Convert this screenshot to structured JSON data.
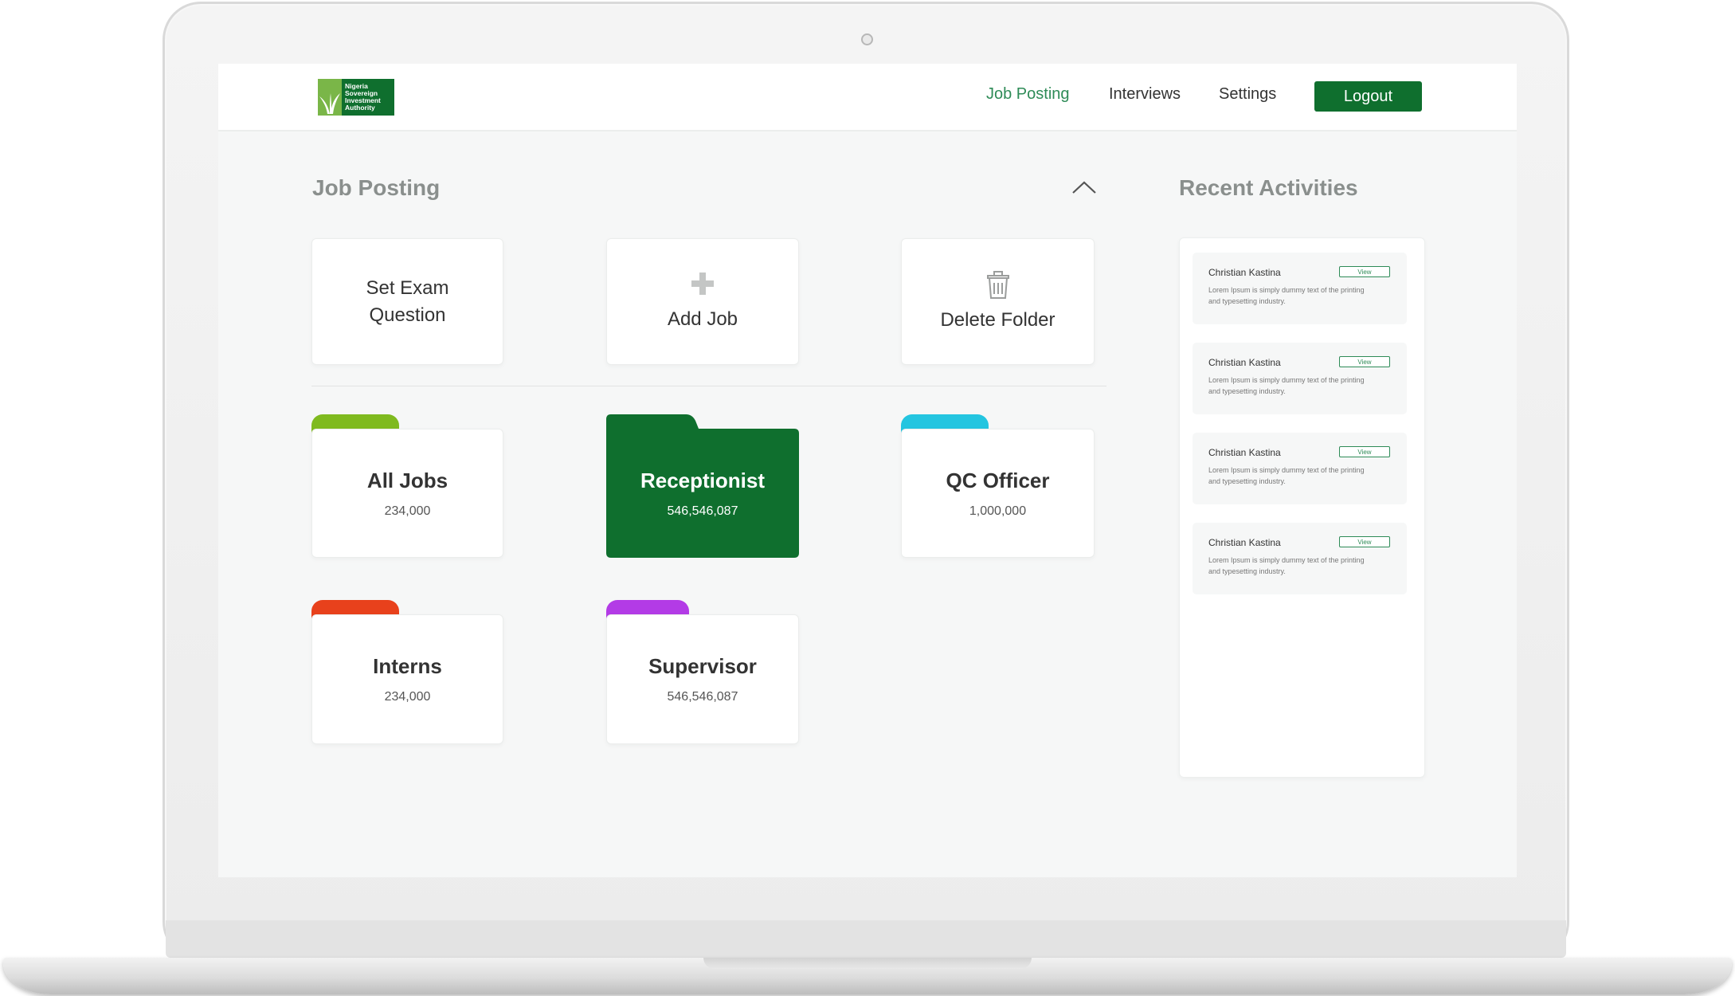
{
  "brand": {
    "logo_text": "Nigeria\nSovereign\nInvestment\nAuthority",
    "primary_color": "#0f6f2e",
    "accent_color": "#2e8b57"
  },
  "nav": {
    "items": [
      {
        "label": "Job Posting",
        "active": true
      },
      {
        "label": "Interviews",
        "active": false
      },
      {
        "label": "Settings",
        "active": false
      }
    ],
    "logout_label": "Logout"
  },
  "job_posting": {
    "title": "Job Posting",
    "collapse_icon": "chevron-up-icon",
    "actions": [
      {
        "label": "Set Exam\nQuestion",
        "icon": ""
      },
      {
        "label": "Add Job",
        "icon": "plus-icon"
      },
      {
        "label": "Delete Folder",
        "icon": "trash-icon"
      }
    ],
    "folders": [
      {
        "name": "All Jobs",
        "count": "234,000",
        "tab_color": "#7fba1f",
        "active": false
      },
      {
        "name": "Receptionist",
        "count": "546,546,087",
        "tab_color": "#0f6f2e",
        "active": true
      },
      {
        "name": "QC Officer",
        "count": "1,000,000",
        "tab_color": "#24c5e0",
        "active": false
      },
      {
        "name": "Interns",
        "count": "234,000",
        "tab_color": "#e8411c",
        "active": false
      },
      {
        "name": "Supervisor",
        "count": "546,546,087",
        "tab_color": "#b33be6",
        "active": false
      }
    ]
  },
  "recent_activities": {
    "title": "Recent Activities",
    "items": [
      {
        "name": "Christian Kastina",
        "view_label": "View",
        "description": "Lorem Ipsum is simply dummy text of the printing and typesetting industry."
      },
      {
        "name": "Christian Kastina",
        "view_label": "View",
        "description": "Lorem Ipsum is simply dummy text of the printing and typesetting industry."
      },
      {
        "name": "Christian Kastina",
        "view_label": "View",
        "description": "Lorem Ipsum is simply dummy text of the printing and typesetting industry."
      },
      {
        "name": "Christian Kastina",
        "view_label": "View",
        "description": "Lorem Ipsum is simply dummy text of the printing and typesetting industry."
      }
    ]
  }
}
